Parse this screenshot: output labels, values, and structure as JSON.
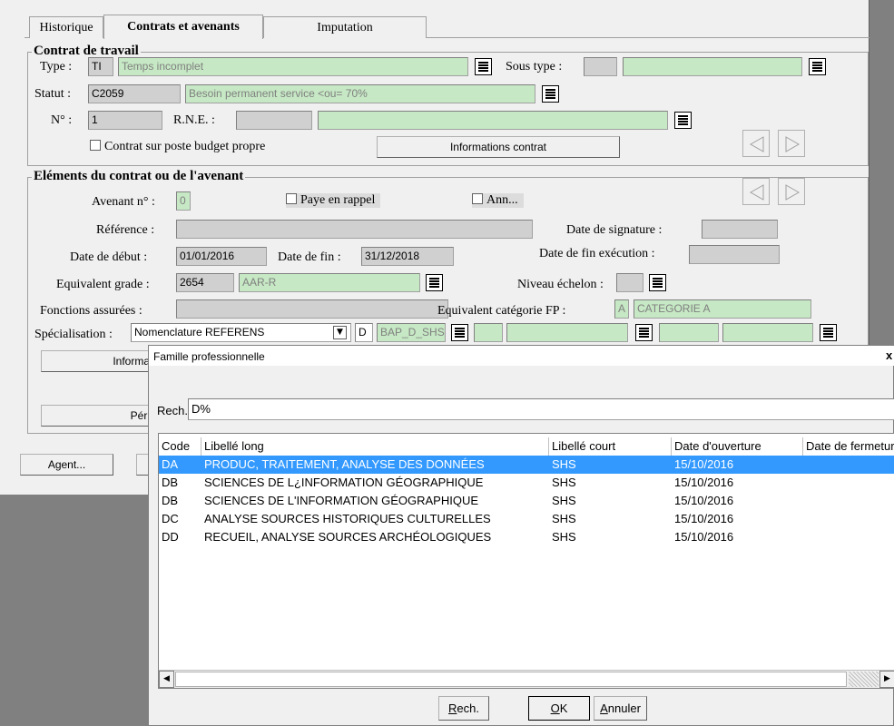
{
  "tabs": [
    "Historique",
    "Contrats et avenants",
    "Imputation"
  ],
  "contrat": {
    "title": "Contrat de travail",
    "type_label": "Type :",
    "type_code": "TI",
    "type_libelle": "Temps incomplet",
    "sous_type_label": "Sous type :",
    "statut_label": "Statut :",
    "statut_code": "C2059",
    "statut_libelle": "Besoin permanent service <ou= 70%",
    "num_label": "N° :",
    "num_value": "1",
    "rne_label": "R.N.E. :",
    "poste_budget_label": "Contrat sur poste budget propre",
    "info_contrat_btn": "Informations contrat"
  },
  "elements": {
    "title": "Eléments du contrat ou de l'avenant",
    "avenant_label": "Avenant n° :",
    "avenant_value": "0",
    "paye_rappel_label": "Paye en rappel",
    "ann_label": "Ann...",
    "reference_label": "Référence :",
    "date_signature_label": "Date de signature :",
    "date_debut_label": "Date de début :",
    "date_debut_value": "01/01/2016",
    "date_fin_label": "Date de fin :",
    "date_fin_value": "31/12/2018",
    "date_fin_exec_label": "Date de fin exécution :",
    "equiv_grade_label": "Equivalent grade :",
    "equiv_grade_code": "2654",
    "equiv_grade_libelle": "AAR-R",
    "niveau_echelon_label": "Niveau échelon :",
    "fonctions_label": "Fonctions assurées :",
    "equiv_cat_label": "Equivalent catégorie FP :",
    "equiv_cat_code": "A",
    "equiv_cat_libelle": "CATEGORIE A",
    "specialisation_label": "Spécialisation :",
    "specialisation_select": "Nomenclature REFERENS",
    "spec_code": "D",
    "spec_bap": "BAP_D_SHS",
    "info_btn_partial": "Informa",
    "peri_btn_partial": "Péri"
  },
  "bottom": {
    "agent_btn": "Agent..."
  },
  "dialog": {
    "title": "Famille professionnelle",
    "close": "x",
    "search_label": "Rech.",
    "search_value": "D%",
    "columns": [
      "Code",
      "Libellé long",
      "Libellé court",
      "Date d'ouverture",
      "Date de fermeture"
    ],
    "rows": [
      {
        "code": "DA",
        "long": "PRODUC, TRAITEMENT, ANALYSE DES DONNÉES",
        "court": "SHS",
        "ouverture": "15/10/2016",
        "fermeture": "",
        "selected": true
      },
      {
        "code": "DB",
        "long": "SCIENCES DE L¿INFORMATION GÉOGRAPHIQUE",
        "court": "SHS",
        "ouverture": "15/10/2016",
        "fermeture": "",
        "selected": false
      },
      {
        "code": "DB",
        "long": "SCIENCES DE L'INFORMATION GÉOGRAPHIQUE",
        "court": "SHS",
        "ouverture": "15/10/2016",
        "fermeture": "",
        "selected": false
      },
      {
        "code": "DC",
        "long": "ANALYSE SOURCES HISTORIQUES CULTURELLES",
        "court": "SHS",
        "ouverture": "15/10/2016",
        "fermeture": "",
        "selected": false
      },
      {
        "code": "DD",
        "long": "RECUEIL, ANALYSE SOURCES ARCHÉOLOGIQUES",
        "court": "SHS",
        "ouverture": "15/10/2016",
        "fermeture": "",
        "selected": false
      }
    ],
    "btn_rech": {
      "accel": "R",
      "rest": "ech."
    },
    "btn_ok": {
      "accel": "O",
      "rest": "K"
    },
    "btn_annuler": {
      "accel": "A",
      "rest": "nnuler"
    }
  },
  "colors": {
    "selection": "#3399ff",
    "readonly_green": "#c6e8c4",
    "panel": "#f0f0f0"
  }
}
